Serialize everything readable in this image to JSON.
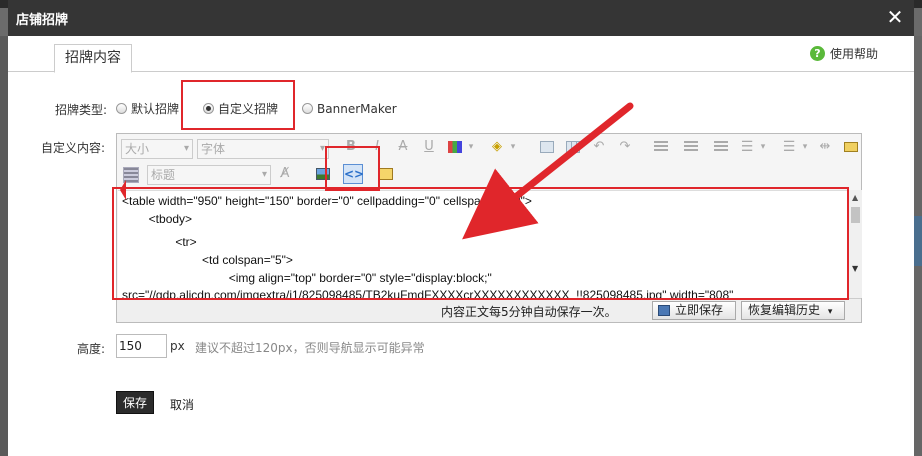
{
  "dialog": {
    "title": "店铺招牌",
    "close_glyph": "✕",
    "tab": "招牌内容",
    "help_label": "使用帮助"
  },
  "sign_type": {
    "label": "招牌类型:",
    "options": [
      {
        "label": "默认招牌",
        "selected": false
      },
      {
        "label": "自定义招牌",
        "selected": true
      },
      {
        "label": "BannerMaker",
        "selected": false
      }
    ]
  },
  "custom_content": {
    "label": "自定义内容:",
    "toolbar": {
      "font_size_placeholder": "大小",
      "font_family_placeholder": "字体",
      "heading_placeholder": "标题"
    },
    "code_lines": [
      "<table width=\"950\" height=\"150\" border=\"0\" cellpadding=\"0\" cellspacing=\"0\">",
      "        <tbody>",
      "                <tr>",
      "                        <td colspan=\"5\">",
      "                                <img align=\"top\" border=\"0\" style=\"display:block;\"",
      "src=\"//gdp.alicdn.com/imgextra/i1/825098485/TB2kuFmdFXXXXcrXXXXXXXXXXXX_!!825098485.jpg\" width=\"808\""
    ],
    "autosave_note": "内容正文每5分钟自动保存一次。",
    "save_now_label": "立即保存",
    "history_label": "恢复编辑历史"
  },
  "height": {
    "label": "高度:",
    "value": "150",
    "unit": "px",
    "hint": "建议不超过120px，否则导航显示可能异常"
  },
  "actions": {
    "save_label": "保存",
    "cancel_label": "取消"
  },
  "colors": {
    "annotation_red": "#e0262b",
    "titlebar": "#353535",
    "help_green": "#5ab93a"
  },
  "icons": {
    "toolbar_row1": [
      "bold-icon",
      "italic-icon",
      "strikethrough-icon",
      "underline-icon",
      "text-color-icon",
      "background-color-icon",
      "image-icon",
      "table-icon",
      "undo-icon",
      "redo-icon",
      "align-left-icon",
      "indent-icon",
      "outdent-icon",
      "unordered-list-icon",
      "ordered-list-icon",
      "horizontal-rule-icon",
      "flash-icon"
    ],
    "toolbar_row2": [
      "heading-icon",
      "clear-format-icon",
      "insert-image-icon",
      "source-code-icon",
      "flash-embed-icon"
    ]
  }
}
